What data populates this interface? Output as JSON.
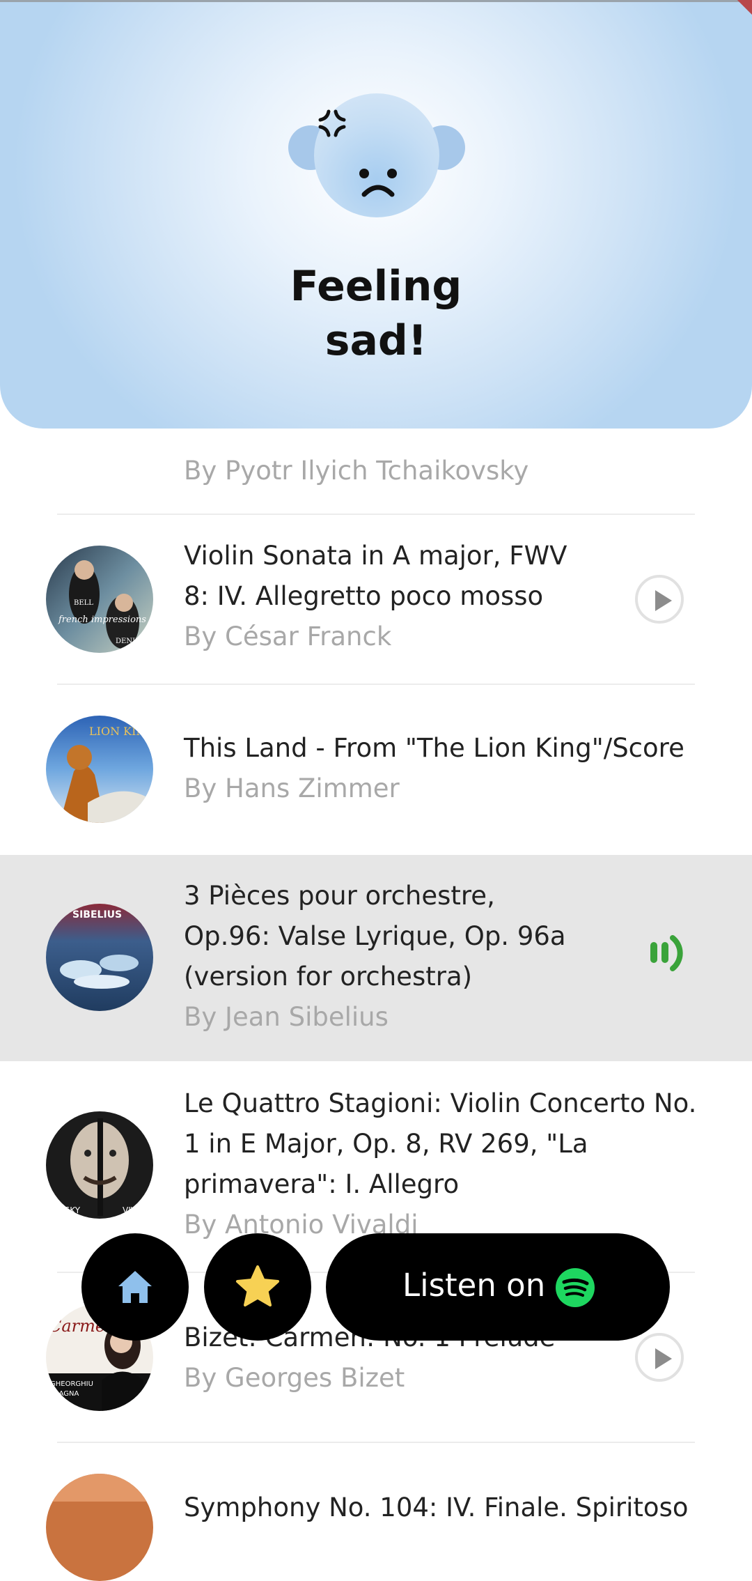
{
  "header": {
    "title_line1": "Feeling",
    "title_line2": "sad!",
    "mood_icon": "sad-face-icon"
  },
  "tracks": [
    {
      "title": "",
      "artist": "By Pyotr Ilyich Tchaikovsky"
    },
    {
      "title_lines": [
        "Violin Sonata in A major, FWV",
        "8: IV. Allegretto poco mosso"
      ],
      "artist": "By César Franck",
      "status": "play"
    },
    {
      "title_lines": [
        "This Land - From \"The Lion King\"/Score"
      ],
      "artist": "By Hans Zimmer",
      "status": "none"
    },
    {
      "title_lines": [
        "3 Pièces pour orchestre,",
        "Op.96: Valse Lyrique, Op. 96a",
        "(version for orchestra)"
      ],
      "artist": "By Jean Sibelius",
      "status": "playing"
    },
    {
      "title_lines": [
        "Le Quattro Stagioni: Violin Concerto No.",
        "1 in E Major, Op. 8, RV 269, \"La",
        "primavera\": I. Allegro"
      ],
      "artist": "By Antonio Vivaldi",
      "status": "none"
    },
    {
      "title_lines": [
        "Bizet: Carmen: No. 1 Prelude"
      ],
      "artist": "By Georges Bizet",
      "status": "play"
    },
    {
      "title_lines": [
        "Symphony No. 104: IV. Finale. Spiritoso"
      ],
      "artist": "",
      "status": "none"
    }
  ],
  "album_art_text": {
    "franck": [
      "BELL",
      "french impressions",
      "DENK"
    ],
    "lion_king": "LION KING",
    "sibelius": "SIBELIUS",
    "carmen": [
      "Carmen",
      "GHEORGHIU",
      "ALAGNA"
    ]
  },
  "bottom_nav": {
    "home_icon": "home-icon",
    "favorites_icon": "star-icon",
    "listen_label": "Listen on",
    "spotify_icon": "spotify-icon"
  },
  "colors": {
    "header_blue": "#b6d5f1",
    "active_row": "#e6e6e6",
    "playing_green": "#3aa33a",
    "spotify_green": "#1ed760",
    "star_yellow": "#f7d154",
    "home_blue": "#8fc0ec"
  }
}
